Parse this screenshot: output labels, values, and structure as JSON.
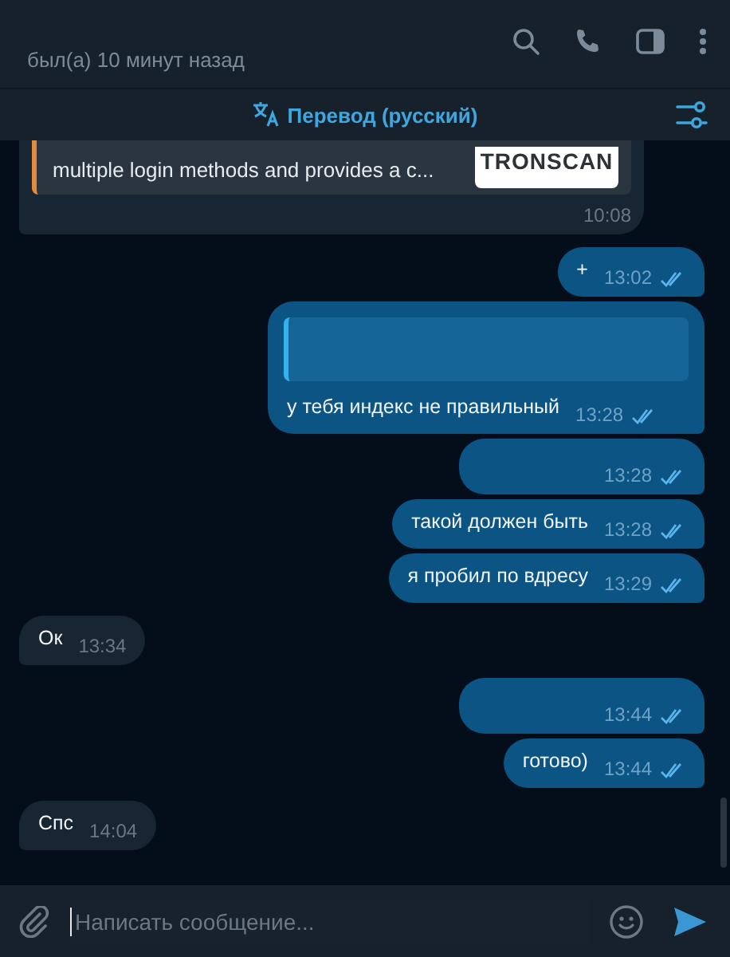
{
  "header": {
    "status": "был(а) 10 минут назад"
  },
  "translate_bar": {
    "label": "Перевод (русский)"
  },
  "messages": [
    {
      "kind": "preview",
      "outgoing": false,
      "preview_text": "multiple login methods and provides a c...",
      "preview_image_text": "TRONSCAN",
      "time": "10:08"
    },
    {
      "kind": "text",
      "outgoing": true,
      "text": "+",
      "time": "13:02",
      "read": true
    },
    {
      "kind": "quote",
      "outgoing": true,
      "text": "у тебя индекс не правильный",
      "time": "13:28",
      "read": true
    },
    {
      "kind": "blank",
      "outgoing": true,
      "time": "13:28",
      "read": true
    },
    {
      "kind": "text",
      "outgoing": true,
      "text": "такой должен быть",
      "time": "13:28",
      "read": true
    },
    {
      "kind": "text",
      "outgoing": true,
      "text": "я пробил по вдресу",
      "time": "13:29",
      "read": true
    },
    {
      "kind": "text",
      "outgoing": false,
      "text": "Ок",
      "time": "13:34"
    },
    {
      "kind": "blank",
      "outgoing": true,
      "time": "13:44",
      "read": true
    },
    {
      "kind": "text",
      "outgoing": true,
      "text": "готово)",
      "time": "13:44",
      "read": true
    },
    {
      "kind": "text",
      "outgoing": false,
      "text": "Спс",
      "time": "14:04"
    }
  ],
  "composer": {
    "placeholder": "Написать сообщение..."
  }
}
